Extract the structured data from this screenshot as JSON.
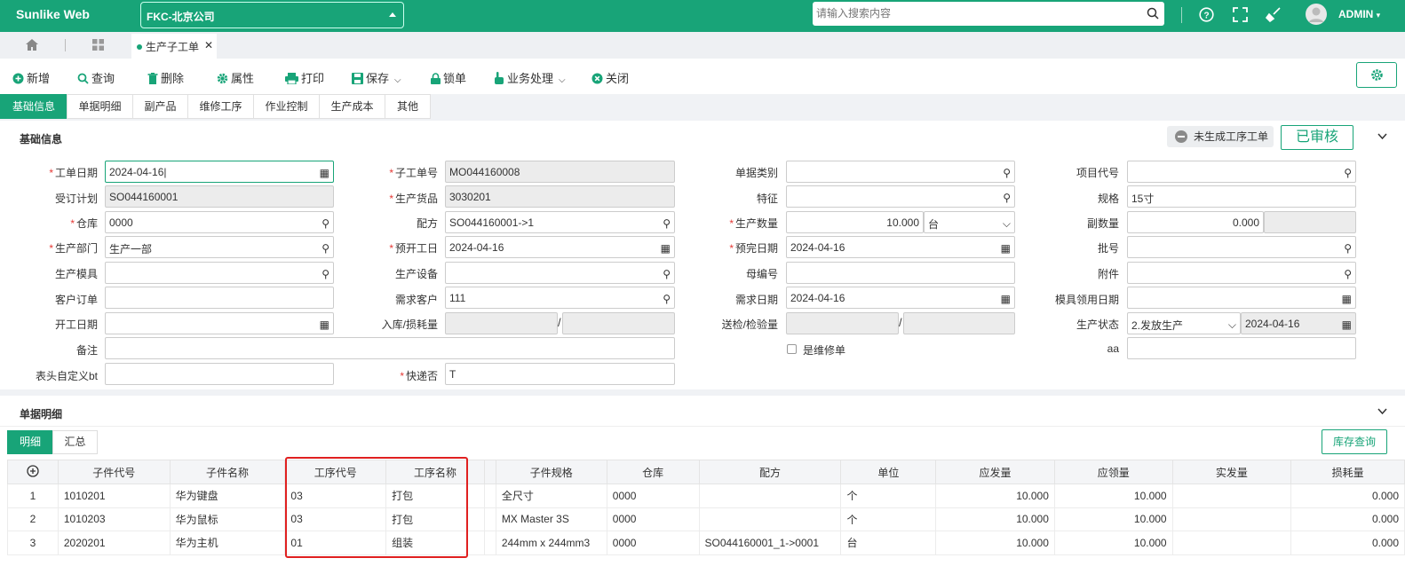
{
  "app": {
    "brand": "Sunlike Web",
    "company": "FKC-北京公司",
    "search_placeholder": "请输入搜索内容",
    "user": "ADMIN"
  },
  "tabs": {
    "active": "生产子工单"
  },
  "toolbar": {
    "new": "新增",
    "query": "查询",
    "delete": "删除",
    "props": "属性",
    "print": "打印",
    "save": "保存",
    "lock": "锁单",
    "business": "业务处理",
    "close": "关闭"
  },
  "subtabs": [
    "基础信息",
    "单据明细",
    "副产品",
    "维修工序",
    "作业控制",
    "生产成本",
    "其他"
  ],
  "basic": {
    "title": "基础信息",
    "gen_status": "未生成工序工单",
    "audit": "已审核"
  },
  "form": {
    "work_date_lbl": "工单日期",
    "work_date": "2024-04-16",
    "sub_no_lbl": "子工单号",
    "sub_no": "MO044160008",
    "doc_type_lbl": "单据类别",
    "doc_type": "",
    "project_lbl": "项目代号",
    "project": "",
    "plan_lbl": "受订计划",
    "plan": "SO044160001",
    "goods_lbl": "生产货品",
    "goods": "3030201",
    "feature_lbl": "特征",
    "feature": "",
    "spec_lbl": "规格",
    "spec": "15寸",
    "wh_lbl": "仓库",
    "wh": "0000",
    "recipe_lbl": "配方",
    "recipe": "SO044160001->1",
    "qty_lbl": "生产数量",
    "qty": "10.000",
    "unit": "台",
    "subqty_lbl": "副数量",
    "subqty": "0.000",
    "dept_lbl": "生产部门",
    "dept": "生产一部",
    "start_lbl": "预开工日",
    "start": "2024-04-16",
    "finish_lbl": "预完日期",
    "finish": "2024-04-16",
    "batch_lbl": "批号",
    "batch": "",
    "mold_lbl": "生产模具",
    "mold": "",
    "equip_lbl": "生产设备",
    "equip": "",
    "parent_lbl": "母编号",
    "parent": "",
    "attach_lbl": "附件",
    "attach": "",
    "custorder_lbl": "客户订单",
    "custorder": "",
    "demandcust_lbl": "需求客户",
    "demandcust": "111",
    "demanddate_lbl": "需求日期",
    "demanddate": "2024-04-16",
    "molddate_lbl": "模具领用日期",
    "molddate": "",
    "opendate_lbl": "开工日期",
    "opendate": "",
    "instock_lbl": "入库/损耗量",
    "sep": "/",
    "inspect_lbl": "送检/检验量",
    "pstatus_lbl": "生产状态",
    "pstatus": "2.发放生产",
    "pstatus_date": "2024-04-16",
    "remark_lbl": "备注",
    "remark": "",
    "repair_lbl": "是维修单",
    "aa_lbl": "aa",
    "aa": "",
    "custom_lbl": "表头自定义bt",
    "custom": "",
    "express_lbl": "快递否",
    "express": "T"
  },
  "detail": {
    "title": "单据明细",
    "tab_detail": "明细",
    "tab_sum": "汇总",
    "stock_btn": "库存查询",
    "columns": [
      "子件代号",
      "子件名称",
      "工序代号",
      "工序名称",
      "子件规格",
      "仓库",
      "配方",
      "单位",
      "应发量",
      "应领量",
      "实发量",
      "损耗量"
    ],
    "rows": [
      [
        "1",
        "1010201",
        "华为键盘",
        "03",
        "打包",
        "全尺寸",
        "0000",
        "",
        "个",
        "10.000",
        "10.000",
        "",
        "0.000"
      ],
      [
        "2",
        "1010203",
        "华为鼠标",
        "03",
        "打包",
        "MX Master 3S",
        "0000",
        "",
        "个",
        "10.000",
        "10.000",
        "",
        "0.000"
      ],
      [
        "3",
        "2020201",
        "华为主机",
        "01",
        "组装",
        "244mm x 244mm3",
        "0000",
        "SO044160001_1->0001",
        "台",
        "10.000",
        "10.000",
        "",
        "0.000"
      ]
    ]
  }
}
